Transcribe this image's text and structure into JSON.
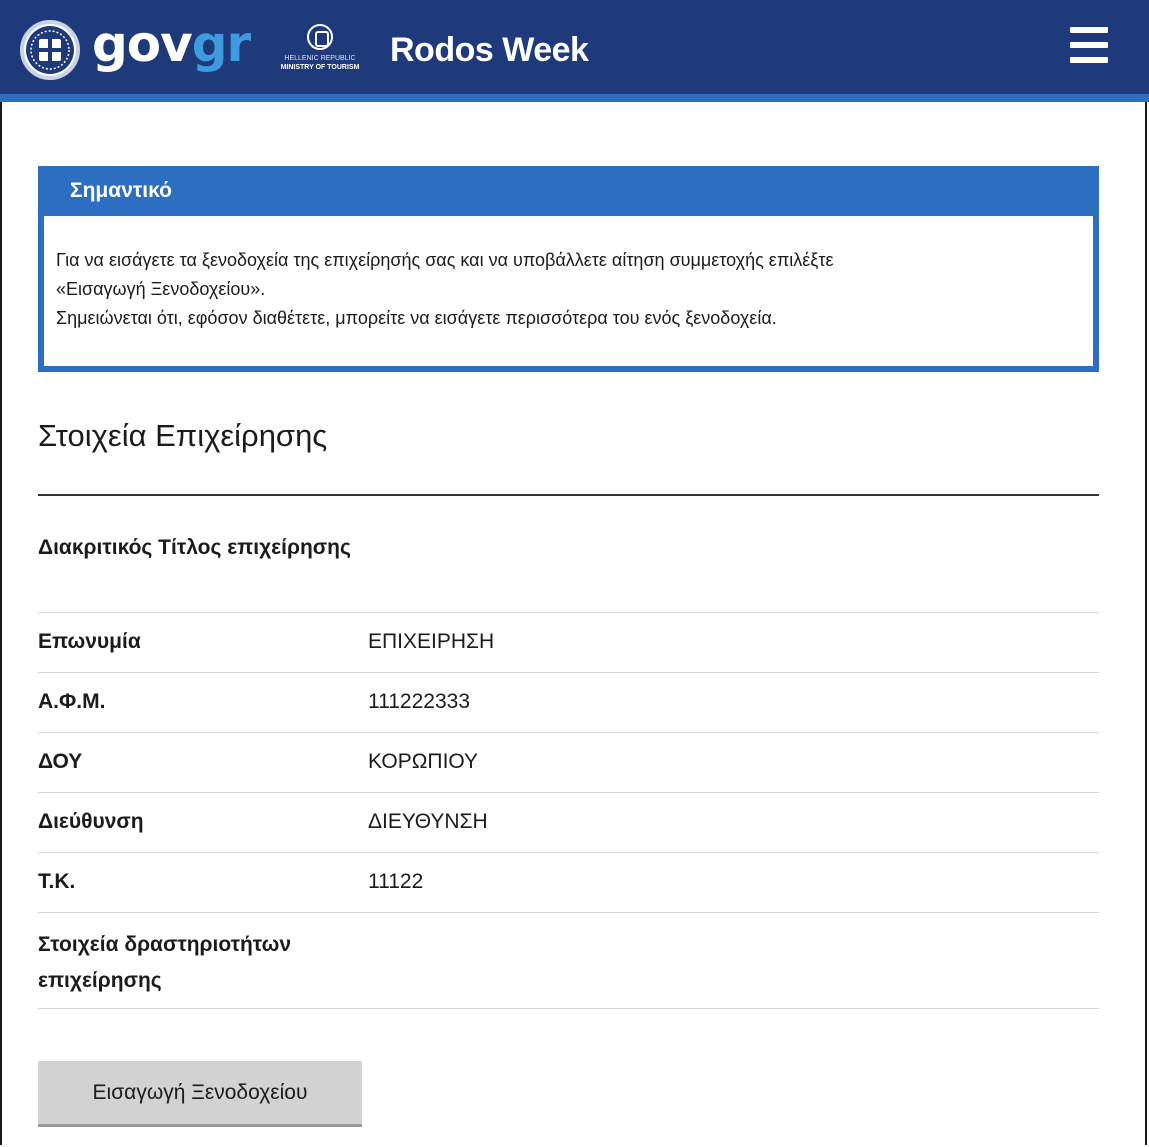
{
  "header": {
    "brand_gov": "gov",
    "brand_gr": "gr",
    "ministry_line1": "HELLENIC REPUBLIC",
    "ministry_line2": "MINISTRY OF TOURISM",
    "app_title": "Rodos Week",
    "emblem_icon": "greek-emblem-icon",
    "menu_icon": "hamburger-menu-icon"
  },
  "notice": {
    "title": "Σημαντικό",
    "line1": "Για να εισάγετε τα ξενοδοχεία της επιχείρησής σας και να υποβάλλετε αίτηση συμμετοχής επιλέξτε",
    "line2": "«Εισαγωγή Ξενοδοχείου».",
    "line3": "Σημειώνεται ότι, εφόσον διαθέτετε, μπορείτε να εισάγετε περισσότερα του ενός ξενοδοχεία."
  },
  "section": {
    "title": "Στοιχεία Επιχείρησης"
  },
  "details": [
    {
      "label": "Διακριτικός Τίτλος επιχείρησης",
      "value": ""
    },
    {
      "label": "Επωνυμία",
      "value": "ΕΠΙΧΕΙΡΗΣΗ"
    },
    {
      "label": "Α.Φ.Μ.",
      "value": "111222333"
    },
    {
      "label": "ΔΟΥ",
      "value": "ΚΟΡΩΠΙΟΥ"
    },
    {
      "label": "Διεύθυνση",
      "value": "ΔΙΕΥΘΥΝΣΗ"
    },
    {
      "label": "Τ.Κ.",
      "value": "11122"
    },
    {
      "label": "Στοιχεία δραστηριοτήτων επιχείρησης",
      "value": ""
    }
  ],
  "actions": {
    "add_hotel_label": "Εισαγωγή Ξενοδοχείου"
  },
  "colors": {
    "header_bg": "#1e3a7a",
    "accent_blue": "#2c6ec0",
    "brand_gr": "#3f9ae0",
    "button_bg": "#d2d2d2"
  }
}
